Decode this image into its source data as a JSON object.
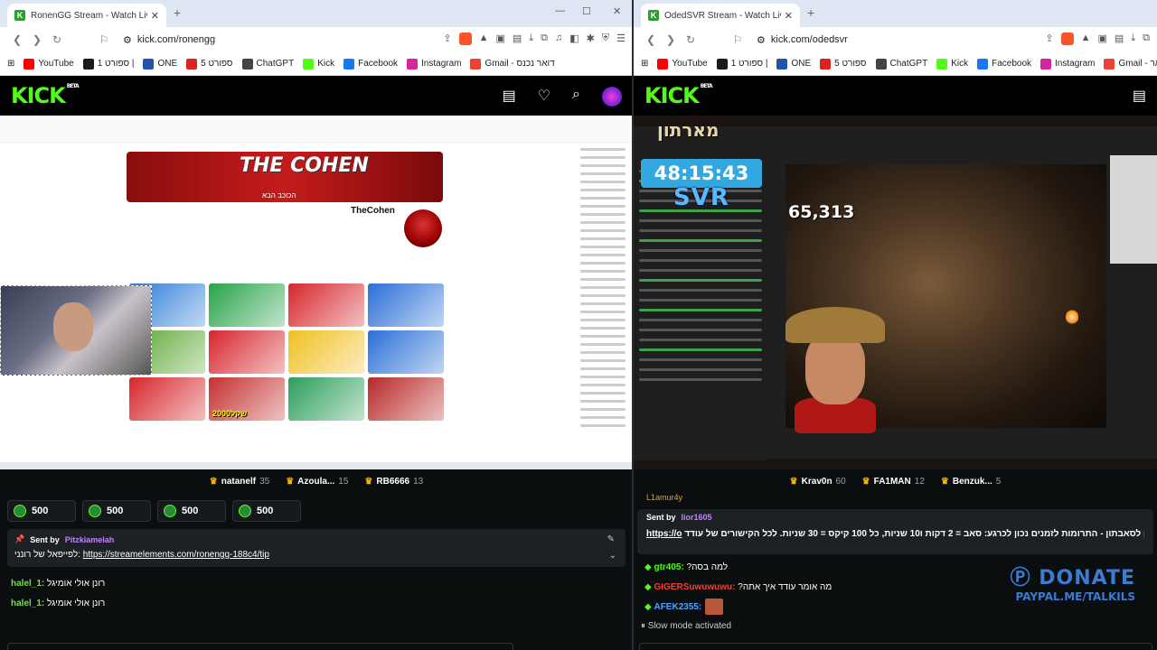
{
  "left": {
    "tab_title": "RonenGG Stream - Watch Live o",
    "url": "kick.com/ronengg",
    "bookmarks": [
      {
        "label": "YouTube",
        "color": "#ff0000"
      },
      {
        "label": "ספורט 1 |",
        "color": "#1b1b1b"
      },
      {
        "label": "ONE",
        "color": "#2255aa"
      },
      {
        "label": "ספורט 5",
        "color": "#d22"
      },
      {
        "label": "ChatGPT",
        "color": "#444"
      },
      {
        "label": "Kick",
        "color": "#53fc18"
      },
      {
        "label": "Facebook",
        "color": "#1877f2"
      },
      {
        "label": "Instagram",
        "color": "#d6249f"
      },
      {
        "label": "Gmail - דואר נכנס",
        "color": "#ea4335"
      }
    ],
    "video": {
      "banner_title": "THE COHEN",
      "banner_subtitle": "הכוכב הבא",
      "channel_name": "TheCohen",
      "thumbnails": [
        {
          "label": "",
          "color": "#2b7bd6"
        },
        {
          "label": "",
          "color": "#27a34a"
        },
        {
          "label": "",
          "color": "#d6262b"
        },
        {
          "label": "",
          "color": "#2a6fd6"
        },
        {
          "label": "",
          "color": "#5ba832"
        },
        {
          "label": "",
          "color": "#d6262b"
        },
        {
          "label": "",
          "color": "#f0c020"
        },
        {
          "label": "",
          "color": "#2a6fd6"
        },
        {
          "label": "",
          "color": "#d6262b"
        },
        {
          "label": "2000שקל",
          "color": "#c43030"
        },
        {
          "label": "",
          "color": "#2b9e5b"
        },
        {
          "label": "",
          "color": "#b82828"
        }
      ]
    },
    "leaderboard": [
      {
        "name": "natanelf",
        "score": "35"
      },
      {
        "name": "Azoula...",
        "score": "15"
      },
      {
        "name": "RB6666",
        "score": "13"
      }
    ],
    "gifts": [
      "500",
      "500",
      "500",
      "500"
    ],
    "pinned": {
      "sent_by_label": "Sent by",
      "user": "Pitzkiamelah",
      "msg_prefix": "לפייפאל של רונני:",
      "link": "https://streamelements.com/ronengg-188c4/tip"
    },
    "messages": [
      {
        "user": "halel_1:",
        "text": "רונן אולי אומיגל"
      },
      {
        "user": "halel_1:",
        "text": "רונן אולי אומיגל"
      }
    ]
  },
  "right": {
    "tab_title": "OdedSVR Stream - Watch Live",
    "url": "kick.com/odedsvr",
    "bookmarks": [
      {
        "label": "YouTube",
        "color": "#ff0000"
      },
      {
        "label": "ספורט 1 |",
        "color": "#1b1b1b"
      },
      {
        "label": "ONE",
        "color": "#2255aa"
      },
      {
        "label": "ספורט 5",
        "color": "#d22"
      },
      {
        "label": "ChatGPT",
        "color": "#444"
      },
      {
        "label": "Kick",
        "color": "#53fc18"
      },
      {
        "label": "Facebook",
        "color": "#1877f2"
      },
      {
        "label": "Instagram",
        "color": "#d6249f"
      },
      {
        "label": "Gmail - דואר",
        "color": "#ea4335"
      }
    ],
    "video": {
      "banner_text": "מארתון",
      "timer": "48:15:43",
      "timer_label": "SVR",
      "counter": "65,313"
    },
    "leaderboard": [
      {
        "name": "Krav0n",
        "score": "60"
      },
      {
        "name": "FA1MAN",
        "score": "12"
      },
      {
        "name": "Benzuk...",
        "score": "5"
      }
    ],
    "top_line": "L1amur4y",
    "sent": {
      "sent_by_label": "Sent by",
      "user": "lior1605",
      "msg": "מחירון לסאבתון - התרומות לזמנים נכון לכרגע: סאב = 2 דקות ו10 שניות, כל 100 קיקס = 30 שניות. לכל הקישורים של עודד :",
      "link": "https://o"
    },
    "messages": [
      {
        "user": "gtr405:",
        "text": "?למה בסה",
        "cls": "u1"
      },
      {
        "user": "GIGERSuwuwuwu:",
        "text": "?מה אומר עודד איך אתה",
        "cls": "u2"
      },
      {
        "user": "AFEK2355:",
        "text": "",
        "cls": "u3"
      }
    ],
    "slow_mode": "Slow mode activated",
    "donate_big": "DONATE",
    "donate_small": "PAYPAL.ME/TALKILS"
  }
}
